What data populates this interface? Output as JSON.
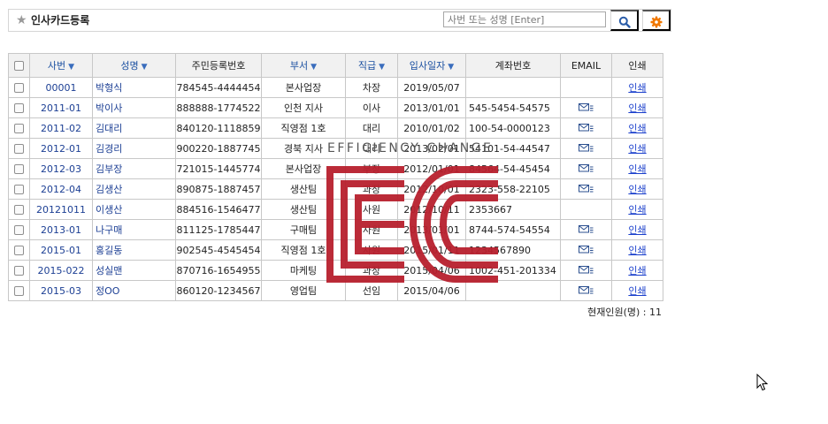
{
  "header": {
    "title": "인사카드등록",
    "search_placeholder": "사번 또는 성명 [Enter]"
  },
  "table": {
    "columns": [
      {
        "label": "사번",
        "sortable": true
      },
      {
        "label": "성명",
        "sortable": true
      },
      {
        "label": "주민등록번호",
        "sortable": false
      },
      {
        "label": "부서",
        "sortable": true
      },
      {
        "label": "직급",
        "sortable": true
      },
      {
        "label": "입사일자",
        "sortable": true
      },
      {
        "label": "계좌번호",
        "sortable": false
      },
      {
        "label": "EMAIL",
        "sortable": false
      },
      {
        "label": "인쇄",
        "sortable": false
      }
    ],
    "rows": [
      {
        "id": "00001",
        "name": "박형식",
        "rrn": "784545-4444454",
        "dept": "본사업장",
        "rank": "차장",
        "date": "2019/05/07",
        "account": "",
        "email": false,
        "print": "인쇄"
      },
      {
        "id": "2011-01",
        "name": "박이사",
        "rrn": "888888-1774522",
        "dept": "인천 지사",
        "rank": "이사",
        "date": "2013/01/01",
        "account": "545-5454-54575",
        "email": true,
        "print": "인쇄"
      },
      {
        "id": "2011-02",
        "name": "김대리",
        "rrn": "840120-1118859",
        "dept": "직영점 1호",
        "rank": "대리",
        "date": "2010/01/02",
        "account": "100-54-0000123",
        "email": true,
        "print": "인쇄"
      },
      {
        "id": "2012-01",
        "name": "김경리",
        "rrn": "900220-1887745",
        "dept": "경북 지사",
        "rank": "대리",
        "date": "2013/02/01",
        "account": "54101-54-44547",
        "email": true,
        "print": "인쇄"
      },
      {
        "id": "2012-03",
        "name": "김부장",
        "rrn": "721015-1445774",
        "dept": "본사업장",
        "rank": "부장",
        "date": "2012/01/01",
        "account": "84564-54-45454",
        "email": true,
        "print": "인쇄"
      },
      {
        "id": "2012-04",
        "name": "김생산",
        "rrn": "890875-1887457",
        "dept": "생산팀",
        "rank": "과장",
        "date": "2012/10/01",
        "account": "2323-558-22105",
        "email": true,
        "print": "인쇄"
      },
      {
        "id": "20121011",
        "name": "이생산",
        "rrn": "884516-1546477",
        "dept": "생산팀",
        "rank": "사원",
        "date": "2012/10/11",
        "account": "2353667",
        "email": false,
        "print": "인쇄"
      },
      {
        "id": "2013-01",
        "name": "나구매",
        "rrn": "811125-1785447",
        "dept": "구매팀",
        "rank": "사원",
        "date": "2013/01/01",
        "account": "8744-574-54554",
        "email": true,
        "print": "인쇄"
      },
      {
        "id": "2015-01",
        "name": "홍길동",
        "rrn": "902545-4545454",
        "dept": "직영점 1호",
        "rank": "사원",
        "date": "2015/01/11",
        "account": "1234567890",
        "email": true,
        "print": "인쇄"
      },
      {
        "id": "2015-022",
        "name": "성실맨",
        "rrn": "870716-1654955",
        "dept": "마케팅",
        "rank": "과장",
        "date": "2015/04/06",
        "account": "1002-451-201334",
        "email": true,
        "print": "인쇄"
      },
      {
        "id": "2015-03",
        "name": "정OO",
        "rrn": "860120-1234567",
        "dept": "영업팀",
        "rank": "선임",
        "date": "2015/04/06",
        "account": "",
        "email": true,
        "print": "인쇄"
      }
    ]
  },
  "footer": {
    "count_label": "현재인원(명) : ",
    "count": "11"
  },
  "watermark": {
    "text": "EFFICIENCY CHANGE",
    "color": "#b8202e"
  },
  "colors": {
    "link": "#1a3fcc",
    "header_bg": "#f1f1f1",
    "gear": "#f07800",
    "search": "#2a5ca8"
  }
}
